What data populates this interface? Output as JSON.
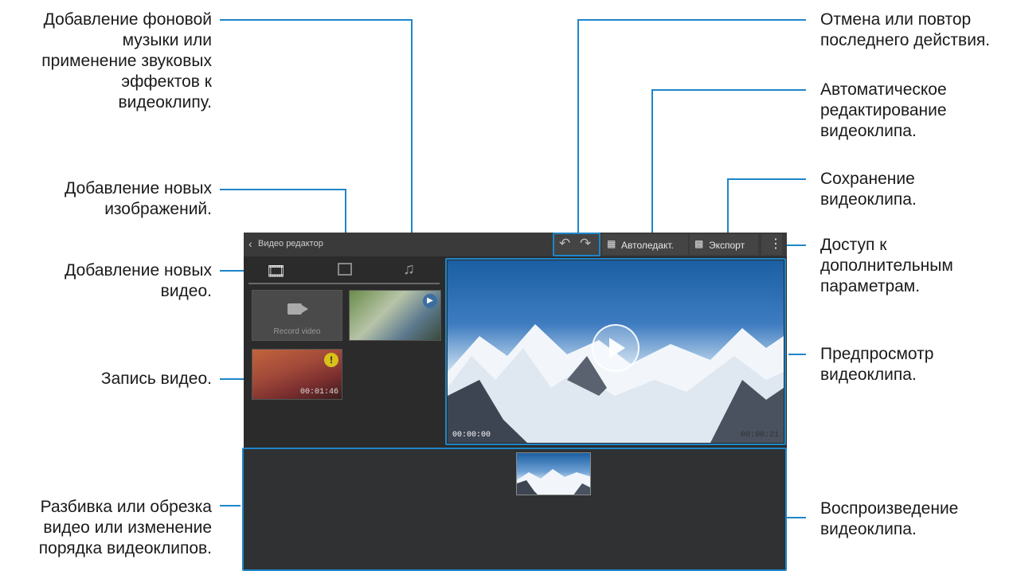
{
  "callouts": {
    "music": "Добавление фоновой\nмузыки или\nприменение звуковых\nэффектов к\nвидеоклипу.",
    "images": "Добавление новых\nизображений.",
    "videos": "Добавление новых\nвидео.",
    "record": "Запись видео.",
    "reorder": "Разбивка или обрезка\nвидео или изменение\nпорядка видеоклипов.",
    "undo_redo": "Отмена или повтор\nпоследнего действия.",
    "auto_edit": "Автоматическое\nредактирование\nвидеоклипа.",
    "save": "Сохранение\nвидеоклипа.",
    "more": "Доступ к\nдополнительным\nпараметрам.",
    "preview": "Предпросмотр\nвидеоклипа.",
    "play": "Воспроизведение\nвидеоклипа."
  },
  "app": {
    "title": "Видео редактор",
    "auto_edit_label": "Автоледакт.",
    "export_label": "Экспорт"
  },
  "library": {
    "record_label": "Record video",
    "clip_duration": "00:01:46"
  },
  "preview": {
    "start_time": "00:00:00",
    "end_time": "00:00:21"
  },
  "colors": {
    "accent": "#1e86c9",
    "app_bg": "#2b2b2b",
    "toolbar_bg": "#3a3a3a"
  }
}
